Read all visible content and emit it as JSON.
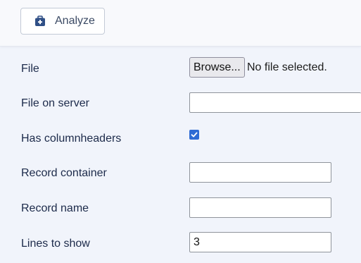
{
  "toolbar": {
    "analyze_label": "Analyze",
    "analyze_icon": "medkit-icon"
  },
  "form": {
    "file": {
      "label": "File",
      "browse_label": "Browse...",
      "status": "No file selected."
    },
    "file_on_server": {
      "label": "File on server",
      "value": ""
    },
    "has_columnheaders": {
      "label": "Has columnheaders",
      "checked": true
    },
    "record_container": {
      "label": "Record container",
      "value": ""
    },
    "record_name": {
      "label": "Record name",
      "value": ""
    },
    "lines_to_show": {
      "label": "Lines to show",
      "value": "3"
    }
  },
  "colors": {
    "accent": "#2e6bd4",
    "icon": "#2f4f86",
    "background": "#f1f4fb",
    "toolbar_background": "#f8f9fc"
  }
}
